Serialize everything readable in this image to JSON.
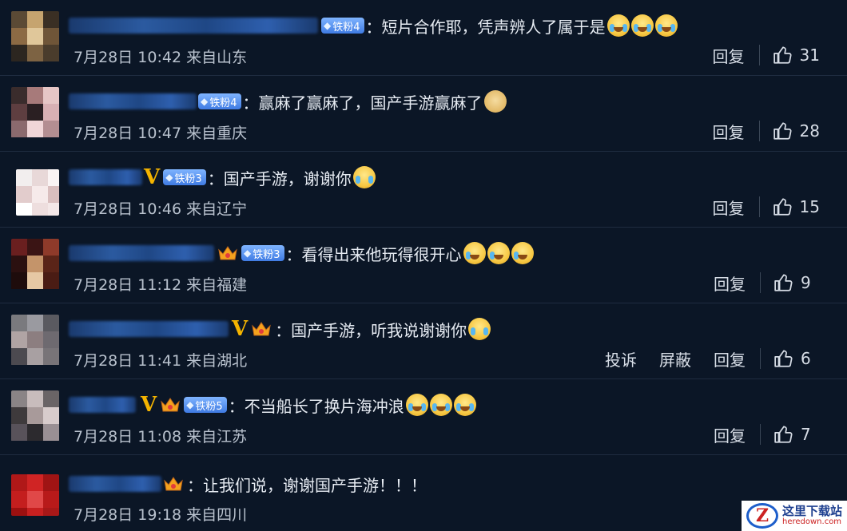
{
  "comments": [
    {
      "badge": "铁粉4",
      "text": "：短片合作耶，凭声辨人了属于是",
      "emojis": [
        "laugh",
        "laugh",
        "laugh"
      ],
      "date": "7月28日 10:42 来自山东",
      "reply": "回复",
      "likes": "31"
    },
    {
      "badge": "铁粉4",
      "text": "：赢麻了赢麻了，国产手游赢麻了",
      "emojis": [
        "doge"
      ],
      "date": "7月28日 10:47 来自重庆",
      "reply": "回复",
      "likes": "28"
    },
    {
      "badge": "铁粉3",
      "text": "：国产手游，谢谢你",
      "emojis": [
        "cry"
      ],
      "date": "7月28日 10:46 来自辽宁",
      "reply": "回复",
      "likes": "15"
    },
    {
      "badge": "铁粉3",
      "text": "：看得出来他玩得很开心",
      "emojis": [
        "lol",
        "lol",
        "lol"
      ],
      "date": "7月28日 11:12 来自福建",
      "reply": "回复",
      "likes": "9"
    },
    {
      "badge": "",
      "text": "：国产手游，听我说谢谢你",
      "emojis": [
        "cry"
      ],
      "date": "7月28日 11:41 来自湖北",
      "report": "投诉",
      "block": "屏蔽",
      "reply": "回复",
      "likes": "6"
    },
    {
      "badge": "铁粉5",
      "text": "：不当船长了换片海冲浪",
      "emojis": [
        "sob",
        "sob",
        "sob"
      ],
      "date": "7月28日 11:08 来自江苏",
      "reply": "回复",
      "likes": "7"
    },
    {
      "badge": "",
      "text": "：让我们说，谢谢国产手游！！！",
      "emojis": [],
      "date": "7月28日 19:18 来自四川",
      "reply": "回复",
      "likes": ""
    }
  ],
  "watermark": {
    "logo_letter": "Z",
    "cn": "这里下载站",
    "en": "heredown.com"
  },
  "colors": {
    "background": "#0b1626",
    "vip_gold": "#f4b400",
    "badge_blue": "#3f7be3"
  }
}
